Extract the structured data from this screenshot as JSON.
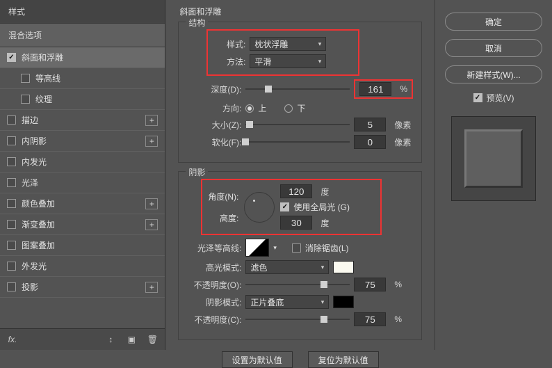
{
  "sidebar": {
    "header1": "样式",
    "header2": "混合选项",
    "items": [
      {
        "label": "斜面和浮雕",
        "checked": true,
        "plus": false,
        "selected": true,
        "sub": false
      },
      {
        "label": "等高线",
        "checked": false,
        "plus": false,
        "selected": false,
        "sub": true
      },
      {
        "label": "纹理",
        "checked": false,
        "plus": false,
        "selected": false,
        "sub": true
      },
      {
        "label": "描边",
        "checked": false,
        "plus": true,
        "selected": false,
        "sub": false
      },
      {
        "label": "内阴影",
        "checked": false,
        "plus": true,
        "selected": false,
        "sub": false
      },
      {
        "label": "内发光",
        "checked": false,
        "plus": false,
        "selected": false,
        "sub": false
      },
      {
        "label": "光泽",
        "checked": false,
        "plus": false,
        "selected": false,
        "sub": false
      },
      {
        "label": "颜色叠加",
        "checked": false,
        "plus": true,
        "selected": false,
        "sub": false
      },
      {
        "label": "渐变叠加",
        "checked": false,
        "plus": true,
        "selected": false,
        "sub": false
      },
      {
        "label": "图案叠加",
        "checked": false,
        "plus": false,
        "selected": false,
        "sub": false
      },
      {
        "label": "外发光",
        "checked": false,
        "plus": false,
        "selected": false,
        "sub": false
      },
      {
        "label": "投影",
        "checked": false,
        "plus": true,
        "selected": false,
        "sub": false
      }
    ],
    "fx": "fx."
  },
  "center": {
    "title": "斜面和浮雕",
    "group_structure": "结构",
    "style_lbl": "样式:",
    "style_val": "枕状浮雕",
    "method_lbl": "方法:",
    "method_val": "平滑",
    "depth_lbl": "深度(D):",
    "depth_val": "161",
    "depth_unit": "%",
    "dir_lbl": "方向:",
    "dir_up": "上",
    "dir_down": "下",
    "size_lbl": "大小(Z):",
    "size_val": "5",
    "size_unit": "像素",
    "soft_lbl": "软化(F):",
    "soft_val": "0",
    "soft_unit": "像素",
    "group_shadow": "阴影",
    "angle_lbl": "角度(N):",
    "angle_val": "120",
    "angle_unit": "度",
    "global_lbl": "使用全局光 (G)",
    "alt_lbl": "高度:",
    "alt_val": "30",
    "alt_unit": "度",
    "gloss_lbl": "光泽等高线:",
    "anti_lbl": "消除锯齿(L)",
    "hmode_lbl": "高光模式:",
    "hmode_val": "滤色",
    "hcolor": "#fbfaf0",
    "hopac_lbl": "不透明度(O):",
    "hopac_val": "75",
    "pct": "%",
    "smode_lbl": "阴影模式:",
    "smode_val": "正片叠底",
    "scolor": "#000000",
    "sopac_lbl": "不透明度(C):",
    "sopac_val": "75",
    "btn_default": "设置为默认值",
    "btn_reset": "复位为默认值"
  },
  "right": {
    "ok": "确定",
    "cancel": "取消",
    "newstyle": "新建样式(W)...",
    "preview": "预览(V)"
  }
}
